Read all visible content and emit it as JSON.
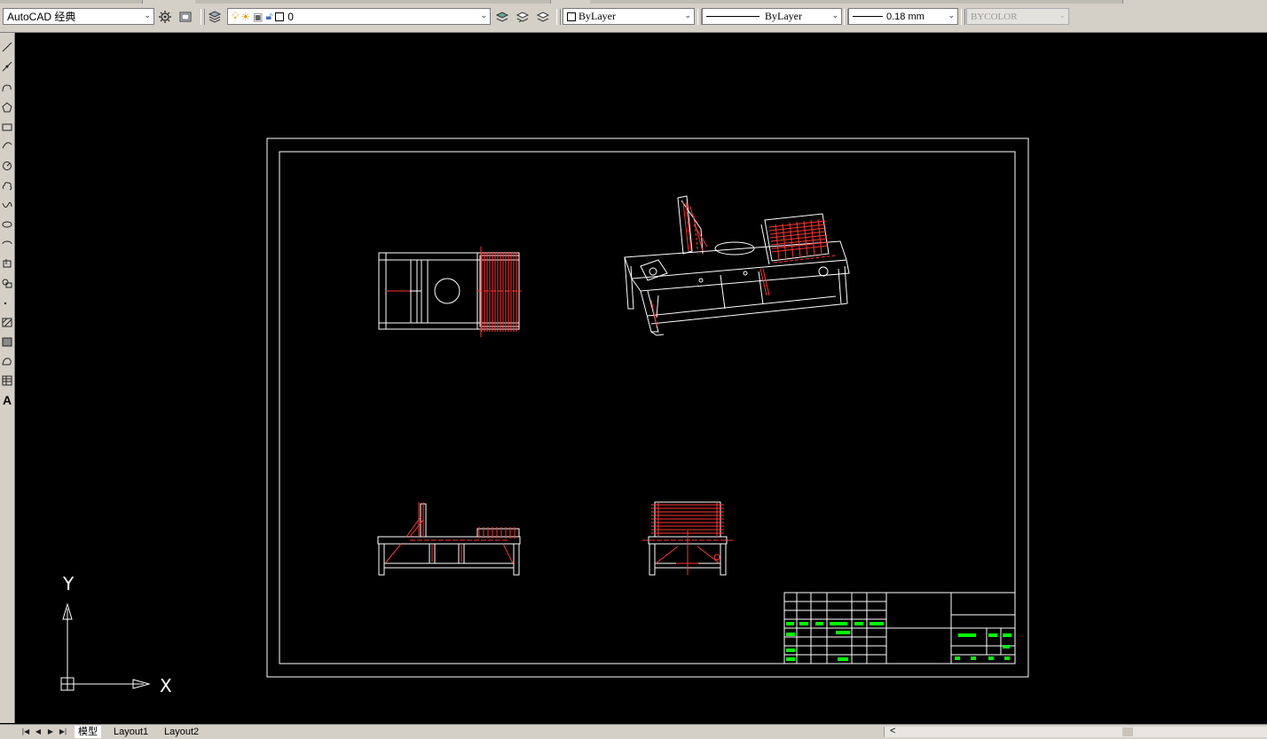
{
  "toolbar": {
    "workspace": "AutoCAD 经典",
    "layer": "0",
    "color": "ByLayer",
    "linetype": "ByLayer",
    "lineweight": "0.18 mm",
    "plotstyle": "BYCOLOR"
  },
  "icons": {
    "workspace_settings": "gear-icon",
    "layer_manager": "layer-properties-icon",
    "layer_on": "lightbulb-icon",
    "layer_freeze": "sun-icon",
    "layer_lock": "lock-icon"
  },
  "ucs": {
    "x_label": "X",
    "y_label": "Y"
  },
  "tabs": [
    "模型",
    "Layout1",
    "Layout2"
  ],
  "colors": {
    "background": "#000000",
    "linework": "#ffffff",
    "centerline": "#ff0000",
    "titleblock_text": "#00ff00",
    "toolbar": "#d4d0c8"
  }
}
